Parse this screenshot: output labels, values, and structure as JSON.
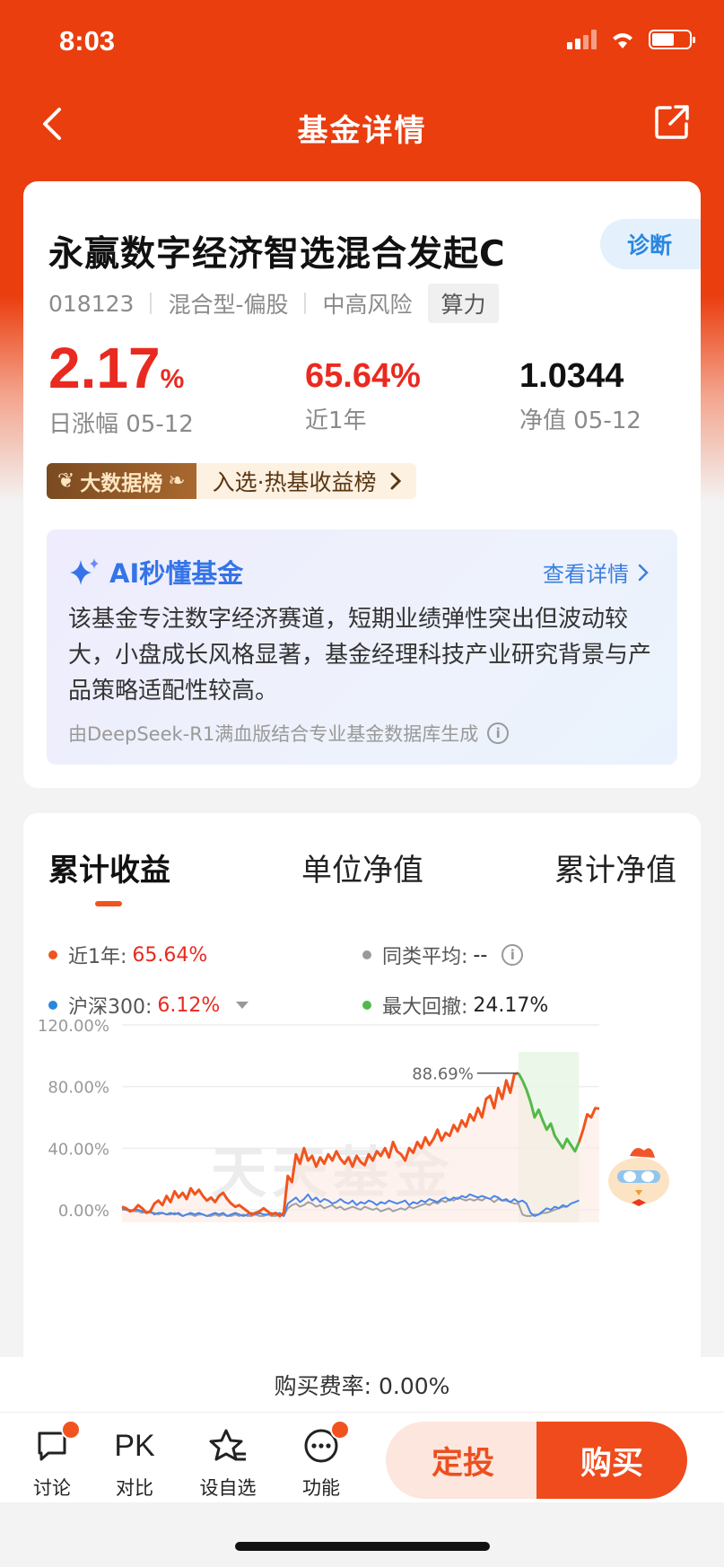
{
  "status": {
    "time": "8:03"
  },
  "nav": {
    "title": "基金详情",
    "back_icon": "chevron-left-icon",
    "share_icon": "share-icon"
  },
  "fund": {
    "name": "永赢数字经济智选混合发起C",
    "diagnose_label": "诊断",
    "code": "018123",
    "type": "混合型-偏股",
    "risk": "中高风险",
    "tag": "算力"
  },
  "stats": {
    "daily_change": "2.17",
    "daily_change_unit": "%",
    "daily_label": "日涨幅 05-12",
    "year_return": "65.64%",
    "year_label": "近1年",
    "nav_value": "1.0344",
    "nav_label": "净值 05-12"
  },
  "rank": {
    "badge": "大数据榜",
    "text": "入选·热基收益榜"
  },
  "ai": {
    "title": "AI秒懂基金",
    "more": "查看详情",
    "description": "该基金专注数字经济赛道，短期业绩弹性突出但波动较大，小盘成长风格显著，基金经理科技产业研究背景与产品策略适配性较高。",
    "source": "由DeepSeek-R1满血版结合专业基金数据库生成"
  },
  "tabs": [
    "累计收益",
    "单位净值",
    "累计净值"
  ],
  "legend": {
    "fund_label": "近1年:",
    "fund_value": "65.64%",
    "peer_label": "同类平均:",
    "peer_value": "--",
    "index_label": "沪深300:",
    "index_value": "6.12%",
    "drawdown_label": "最大回撤:",
    "drawdown_value": "24.17%"
  },
  "chart_data": {
    "type": "line",
    "yticks": [
      "120.00%",
      "80.00%",
      "40.00%",
      "0.00%"
    ],
    "ylim": [
      -4,
      120
    ],
    "peak_label": "88.69%",
    "watermark": "天天基金",
    "colors": {
      "fund": "#f0551d",
      "index": "#4a86e8",
      "peer": "#a0a0a0",
      "drawdown": "#55b84a"
    },
    "series": [
      {
        "name": "近1年",
        "values": [
          2,
          1,
          -1,
          0,
          3,
          1,
          -2,
          -1,
          4,
          6,
          3,
          9,
          5,
          12,
          8,
          11,
          7,
          14,
          10,
          13,
          9,
          6,
          8,
          5,
          9,
          11,
          7,
          4,
          2,
          3,
          1,
          -1,
          -3,
          -2,
          -1,
          1,
          -1,
          -3,
          -2,
          -4,
          -2,
          22,
          18,
          36,
          30,
          40,
          32,
          35,
          28,
          34,
          30,
          36,
          32,
          38,
          33,
          30,
          34,
          28,
          35,
          31,
          29,
          36,
          32,
          38,
          35,
          40,
          34,
          44,
          38,
          36,
          32,
          40,
          37,
          44,
          40,
          47,
          42,
          46,
          52,
          45,
          50,
          48,
          55,
          51,
          58,
          54,
          62,
          58,
          66,
          60,
          72,
          74,
          66,
          79,
          72,
          84,
          76,
          88,
          88.69,
          84,
          78,
          70,
          60,
          65,
          58,
          52,
          56,
          48,
          44,
          40,
          46,
          42,
          38,
          44,
          52,
          62,
          60,
          66,
          65.64
        ]
      },
      {
        "name": "沪深300",
        "values": [
          1,
          0,
          -1,
          0,
          0,
          -1,
          -2,
          -1,
          -3,
          -2,
          -2,
          -3,
          -2,
          -3,
          -2,
          -4,
          -3,
          -2,
          -3,
          -2,
          -3,
          -4,
          -3,
          -2,
          -3,
          -2,
          -4,
          -3,
          -2,
          -3,
          -4,
          -3,
          -2,
          -3,
          -2,
          -3,
          -3,
          -2,
          -3,
          -2,
          -4,
          4,
          6,
          8,
          5,
          7,
          10,
          6,
          8,
          5,
          7,
          6,
          4,
          5,
          7,
          5,
          4,
          6,
          3,
          5,
          4,
          6,
          5,
          3,
          5,
          4,
          6,
          5,
          4,
          5,
          6,
          3,
          5,
          4,
          6,
          5,
          7,
          6,
          5,
          7,
          8,
          6,
          8,
          7,
          9,
          8,
          10,
          9,
          8,
          9,
          8,
          7,
          9,
          8,
          6,
          7,
          5,
          7,
          5,
          6,
          4,
          -2,
          -4,
          -3,
          -1,
          1,
          0,
          2,
          1,
          3,
          2,
          4,
          5,
          6.12
        ]
      },
      {
        "name": "同类平均",
        "values": [
          0,
          0,
          0,
          -1,
          -1,
          -2,
          -1,
          -2,
          -2,
          -3,
          -2,
          -3,
          -3,
          -2,
          -3,
          -4,
          -3,
          -3,
          -4,
          -3,
          -3,
          -4,
          -4,
          -3,
          -4,
          -3,
          -4,
          -4,
          -3,
          -4,
          -3,
          -4,
          -4,
          -3,
          -4,
          -4,
          -3,
          -4,
          -4,
          -3,
          -4,
          1,
          3,
          4,
          2,
          3,
          5,
          4,
          2,
          3,
          1,
          2,
          3,
          1,
          2,
          0,
          1,
          2,
          1,
          0,
          2,
          1,
          0,
          1,
          -1,
          0,
          1,
          -1,
          0,
          1,
          0,
          2,
          1,
          2,
          3,
          4,
          3,
          5,
          4,
          6,
          5,
          7,
          6,
          8,
          7,
          6,
          7,
          6,
          7,
          6,
          8,
          7,
          5,
          7,
          6,
          6,
          5,
          4,
          4,
          -3,
          -4,
          -4,
          -3,
          -3,
          -2,
          -2,
          -1,
          0,
          1,
          2,
          2
        ]
      }
    ]
  },
  "fee": {
    "label": "购买费率: 0.00%"
  },
  "bottom": {
    "discuss": "讨论",
    "compare_icon_text": "PK",
    "compare": "对比",
    "watch": "设自选",
    "functions": "功能",
    "fixed_invest": "定投",
    "buy": "购买"
  }
}
